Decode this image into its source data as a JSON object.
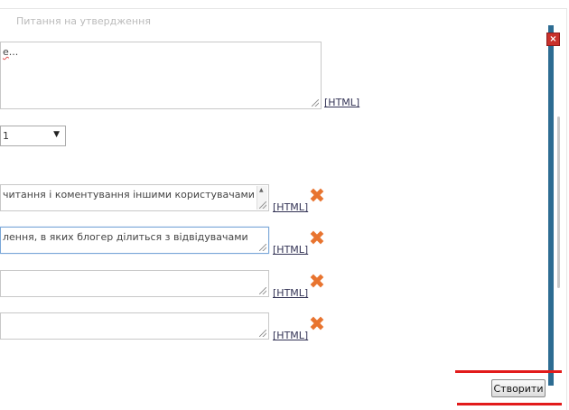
{
  "header": {
    "faded_text": "Питання на утвердження"
  },
  "main_textarea": {
    "value_prefix": "",
    "value_misspelled": "е",
    "value_suffix": "..."
  },
  "main_html_link": "[HTML]",
  "select": {
    "value": "1"
  },
  "answers": [
    {
      "value": "читання і коментування іншими користувачами",
      "html_link": "[HTML]",
      "delete_icon": "close-x-icon"
    },
    {
      "value": "лення, в яких блогер ділиться з відвідувачами",
      "html_link": "[HTML]",
      "delete_icon": "close-x-icon"
    },
    {
      "value": "",
      "html_link": "[HTML]",
      "delete_icon": "close-x-icon"
    },
    {
      "value": "",
      "html_link": "[HTML]",
      "delete_icon": "close-x-icon"
    }
  ],
  "window": {
    "close_icon": "close-icon"
  },
  "create_button": "Створити",
  "colors": {
    "sidebar": "#2d6c92",
    "delete_icon": "#e8742f",
    "highlight_line": "#e21b1b"
  }
}
